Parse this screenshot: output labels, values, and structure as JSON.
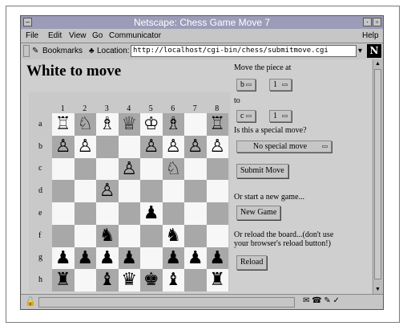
{
  "window": {
    "title": "Netscape: Chess Game Move 7"
  },
  "menu": [
    "File",
    "Edit",
    "View",
    "Go",
    "Communicator",
    "Help"
  ],
  "location_bar": {
    "bookmarks_label": "Bookmarks",
    "location_label": "Location:",
    "url": "http://localhost/cgi-bin/chess/submitmove.cgi"
  },
  "page": {
    "heading": "White to move",
    "board": {
      "col_labels": [
        "1",
        "2",
        "3",
        "4",
        "5",
        "6",
        "7",
        "8"
      ],
      "row_labels": [
        "a",
        "b",
        "c",
        "d",
        "e",
        "f",
        "g",
        "h"
      ],
      "rows": [
        [
          "♖",
          "♘",
          "♗",
          "♕",
          "♔",
          "♗",
          "",
          "♖"
        ],
        [
          "♙",
          "♙",
          "",
          "",
          "♙",
          "♙",
          "♙",
          "♙"
        ],
        [
          "",
          "",
          "",
          "♙",
          "",
          "♘",
          "",
          ""
        ],
        [
          "",
          "",
          "♙",
          "",
          "",
          "",
          "",
          ""
        ],
        [
          "",
          "",
          "",
          "",
          "♟",
          "",
          "",
          ""
        ],
        [
          "",
          "",
          "♞",
          "",
          "",
          "♞",
          "",
          ""
        ],
        [
          "♟",
          "♟",
          "♟",
          "♟",
          "",
          "♟",
          "♟",
          "♟"
        ],
        [
          "♜",
          "",
          "♝",
          "♛",
          "♚",
          "♝",
          "",
          "♜"
        ]
      ]
    },
    "form": {
      "move_label": "Move the piece at",
      "from_col": "b",
      "from_row": "1",
      "to_label": "to",
      "to_col": "c",
      "to_row": "1",
      "special_label": "Is this a special move?",
      "special_value": "No special move",
      "submit_label": "Submit Move",
      "new_game_label": "Or start a new game...",
      "new_game_button": "New Game",
      "reload_line1": "Or reload the board...(don't use",
      "reload_line2": "your browser's reload button!)",
      "reload_button": "Reload"
    }
  },
  "colors": {
    "titlebar": "#9c9cb8",
    "light_square": "#f7f7f7",
    "dark_square": "#a8a8a8",
    "chrome": "#c6c6c6"
  }
}
